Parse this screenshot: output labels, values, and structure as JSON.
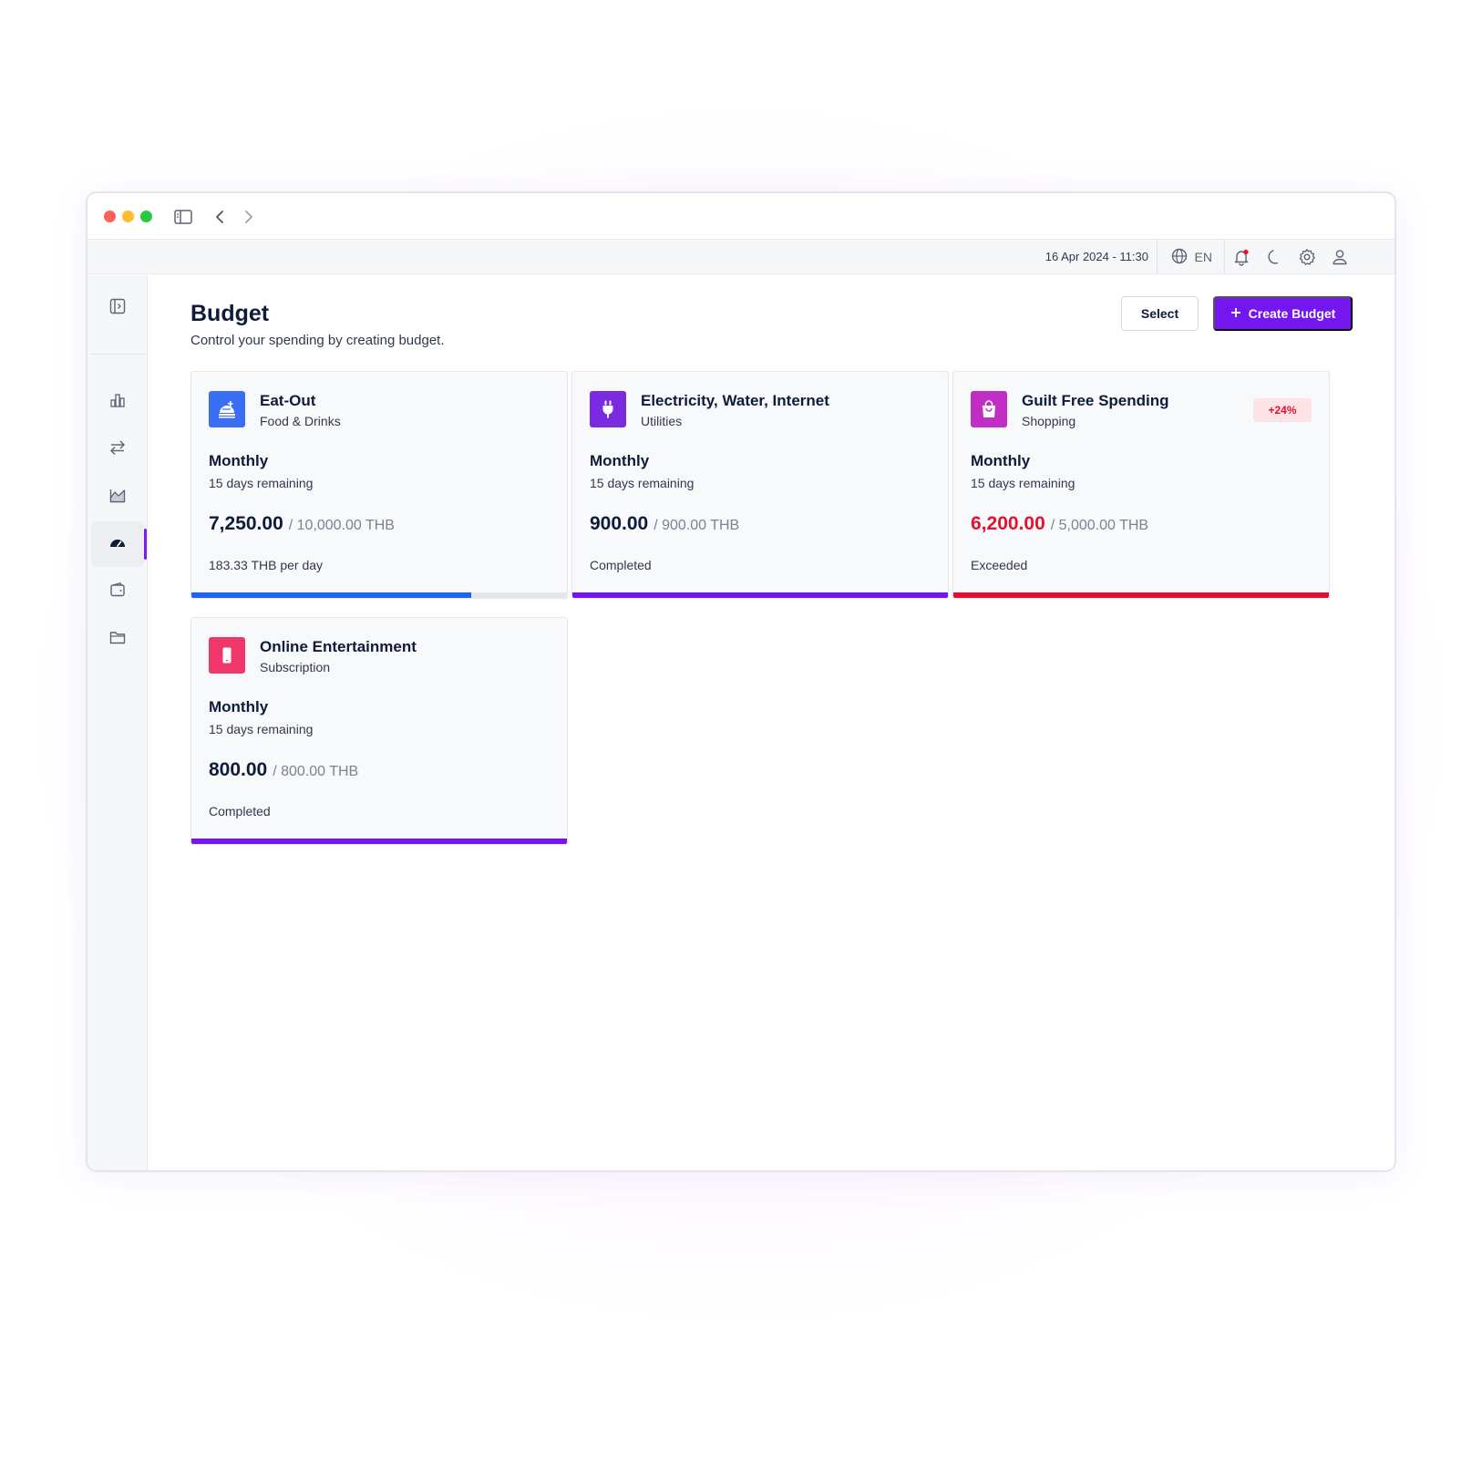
{
  "header": {
    "datetime": "16 Apr 2024 - 11:30",
    "language": "EN"
  },
  "page": {
    "title": "Budget",
    "subtitle": "Control your spending by creating budget.",
    "select_label": "Select",
    "create_label": "Create Budget"
  },
  "colors": {
    "accent": "#7515ef",
    "blue": "#1b63f0",
    "danger": "#e3102f"
  },
  "budgets": [
    {
      "name": "Eat-Out",
      "category": "Food & Drinks",
      "icon": "food-drinks-icon",
      "icon_color": "#3a6ef5",
      "period": "Monthly",
      "remaining": "15 days remaining",
      "spent": "7,250.00",
      "total": "/ 10,000.00 THB",
      "status": "183.33 THB per day",
      "progress": 0.745,
      "bar_color": "#1b63f0",
      "badge": ""
    },
    {
      "name": "Electricity, Water, Internet",
      "category": "Utilities",
      "icon": "plug-icon",
      "icon_color": "#7a2be0",
      "period": "Monthly",
      "remaining": "15 days remaining",
      "spent": "900.00",
      "total": "/ 900.00 THB",
      "status": "Completed",
      "progress": 1.0,
      "bar_color": "#7515ef",
      "badge": ""
    },
    {
      "name": "Guilt Free Spending",
      "category": "Shopping",
      "icon": "shopping-bag-icon",
      "icon_color": "#c02ec6",
      "period": "Monthly",
      "remaining": "15 days remaining",
      "spent": "6,200.00",
      "total": "/ 5,000.00 THB",
      "status": "Exceeded",
      "progress": 1.0,
      "bar_color": "#e3102f",
      "badge": "+24%"
    },
    {
      "name": "Online Entertainment",
      "category": "Subscription",
      "icon": "phone-icon",
      "icon_color": "#f0376a",
      "period": "Monthly",
      "remaining": "15 days remaining",
      "spent": "800.00",
      "total": "/ 800.00 THB",
      "status": "Completed",
      "progress": 1.0,
      "bar_color": "#7515ef",
      "badge": ""
    }
  ]
}
